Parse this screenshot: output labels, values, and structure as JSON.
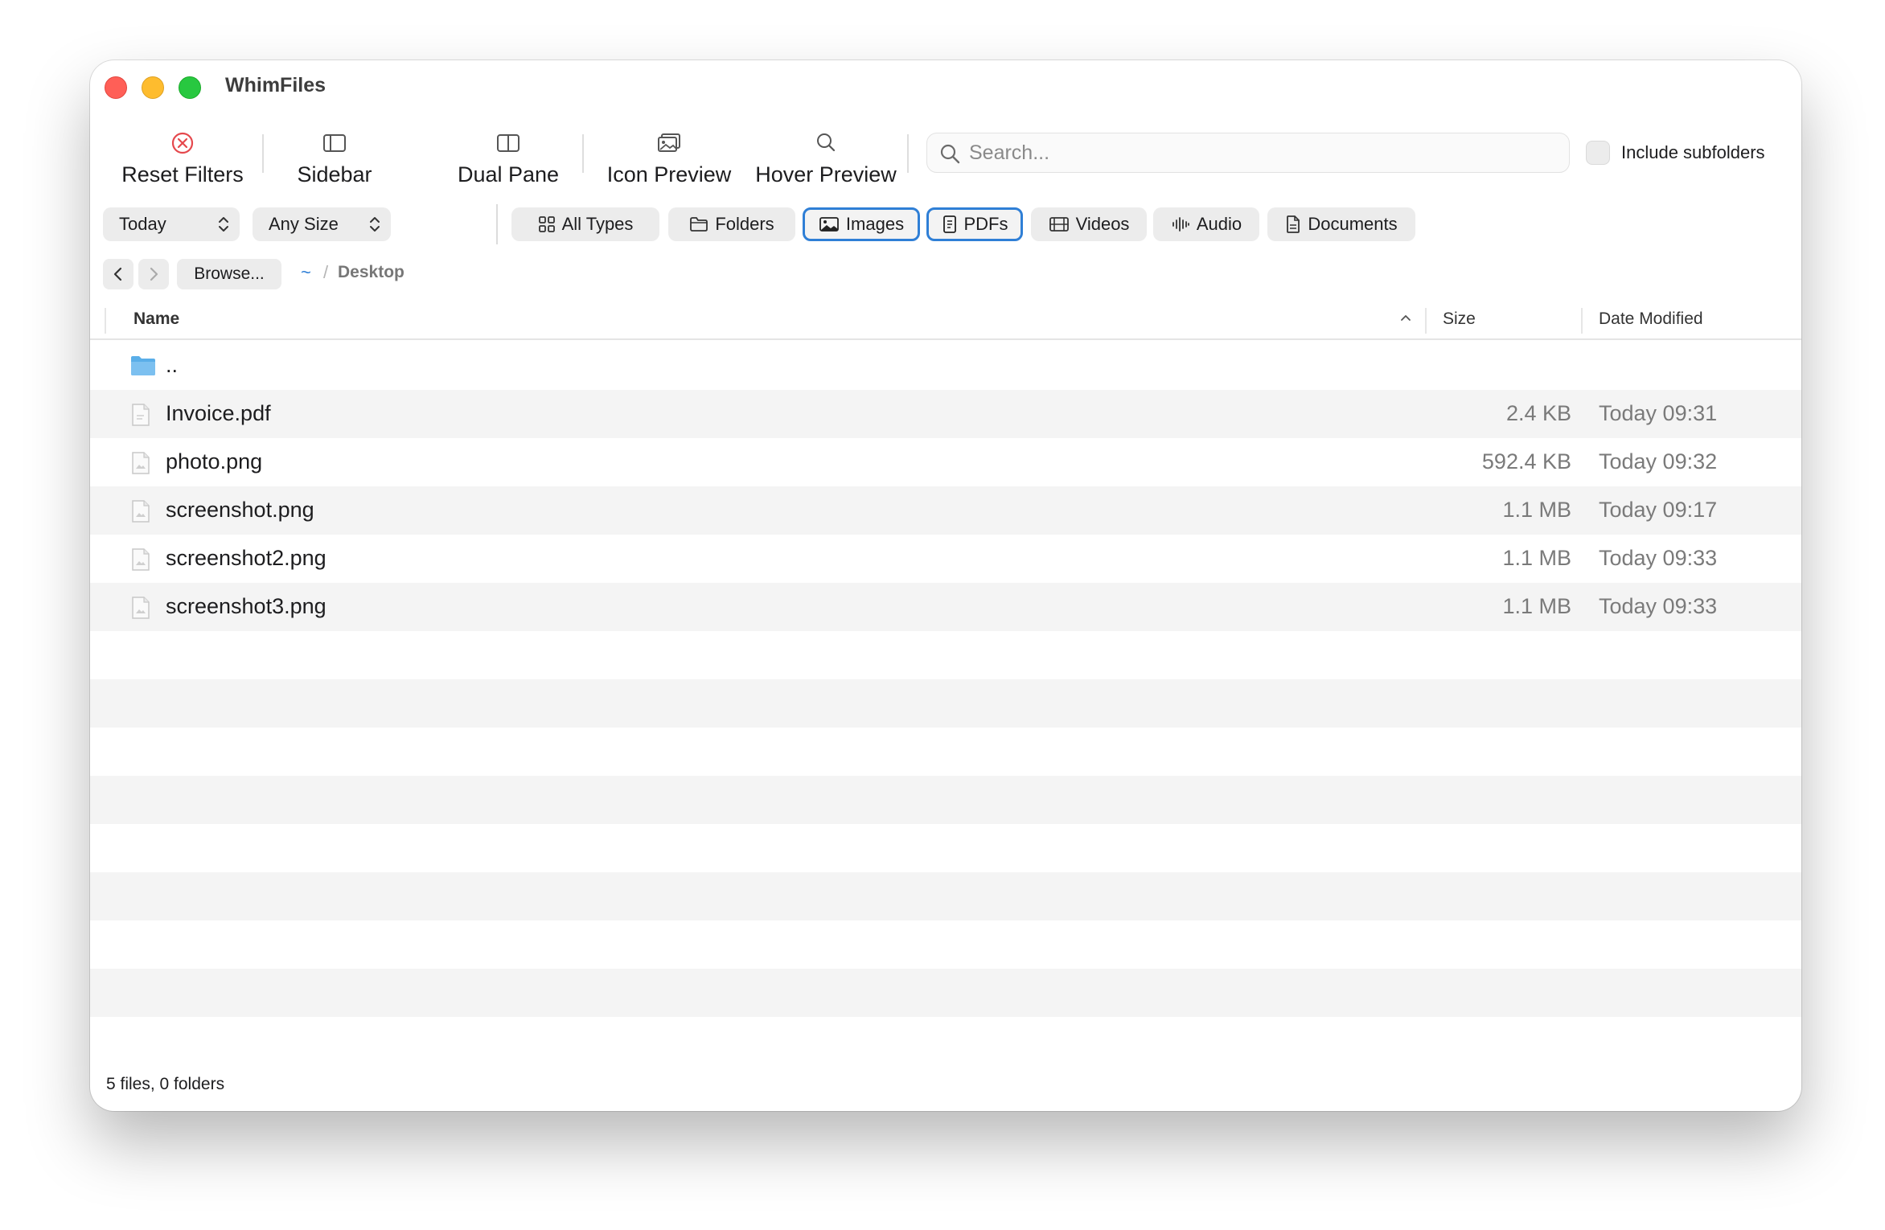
{
  "window": {
    "title": "WhimFiles"
  },
  "toolbar": {
    "reset_filters": "Reset Filters",
    "sidebar": "Sidebar",
    "dual_pane": "Dual Pane",
    "icon_preview": "Icon Preview",
    "hover_preview": "Hover Preview",
    "search_placeholder": "Search...",
    "include_subfolders": "Include subfolders"
  },
  "filters": {
    "date": "Today",
    "size": "Any Size",
    "types": [
      {
        "label": "All Types",
        "icon": "grid-icon",
        "active": false
      },
      {
        "label": "Folders",
        "icon": "folder-icon",
        "active": false
      },
      {
        "label": "Images",
        "icon": "image-icon",
        "active": true
      },
      {
        "label": "PDFs",
        "icon": "pdf-icon",
        "active": true
      },
      {
        "label": "Videos",
        "icon": "film-icon",
        "active": false
      },
      {
        "label": "Audio",
        "icon": "waveform-icon",
        "active": false
      },
      {
        "label": "Documents",
        "icon": "document-icon",
        "active": false
      }
    ]
  },
  "nav": {
    "browse": "Browse...",
    "home": "~",
    "separator": "/",
    "current": "Desktop"
  },
  "table": {
    "columns": {
      "name": "Name",
      "size": "Size",
      "date": "Date Modified"
    },
    "rows": [
      {
        "name": "..",
        "size": "",
        "date": "",
        "kind": "folder"
      },
      {
        "name": "Invoice.pdf",
        "size": "2.4 KB",
        "date": "Today 09:31",
        "kind": "file"
      },
      {
        "name": "photo.png",
        "size": "592.4 KB",
        "date": "Today 09:32",
        "kind": "file"
      },
      {
        "name": "screenshot.png",
        "size": "1.1 MB",
        "date": "Today 09:17",
        "kind": "file"
      },
      {
        "name": "screenshot2.png",
        "size": "1.1 MB",
        "date": "Today 09:33",
        "kind": "file"
      },
      {
        "name": "screenshot3.png",
        "size": "1.1 MB",
        "date": "Today 09:33",
        "kind": "file"
      }
    ]
  },
  "status": "5 files, 0 folders",
  "colors": {
    "accent": "#2f7fd6",
    "alt_row": "#f4f4f4",
    "folder": "#5aaee8",
    "close": "#ff5f57",
    "minimize": "#febc2e",
    "zoom": "#28c840"
  }
}
